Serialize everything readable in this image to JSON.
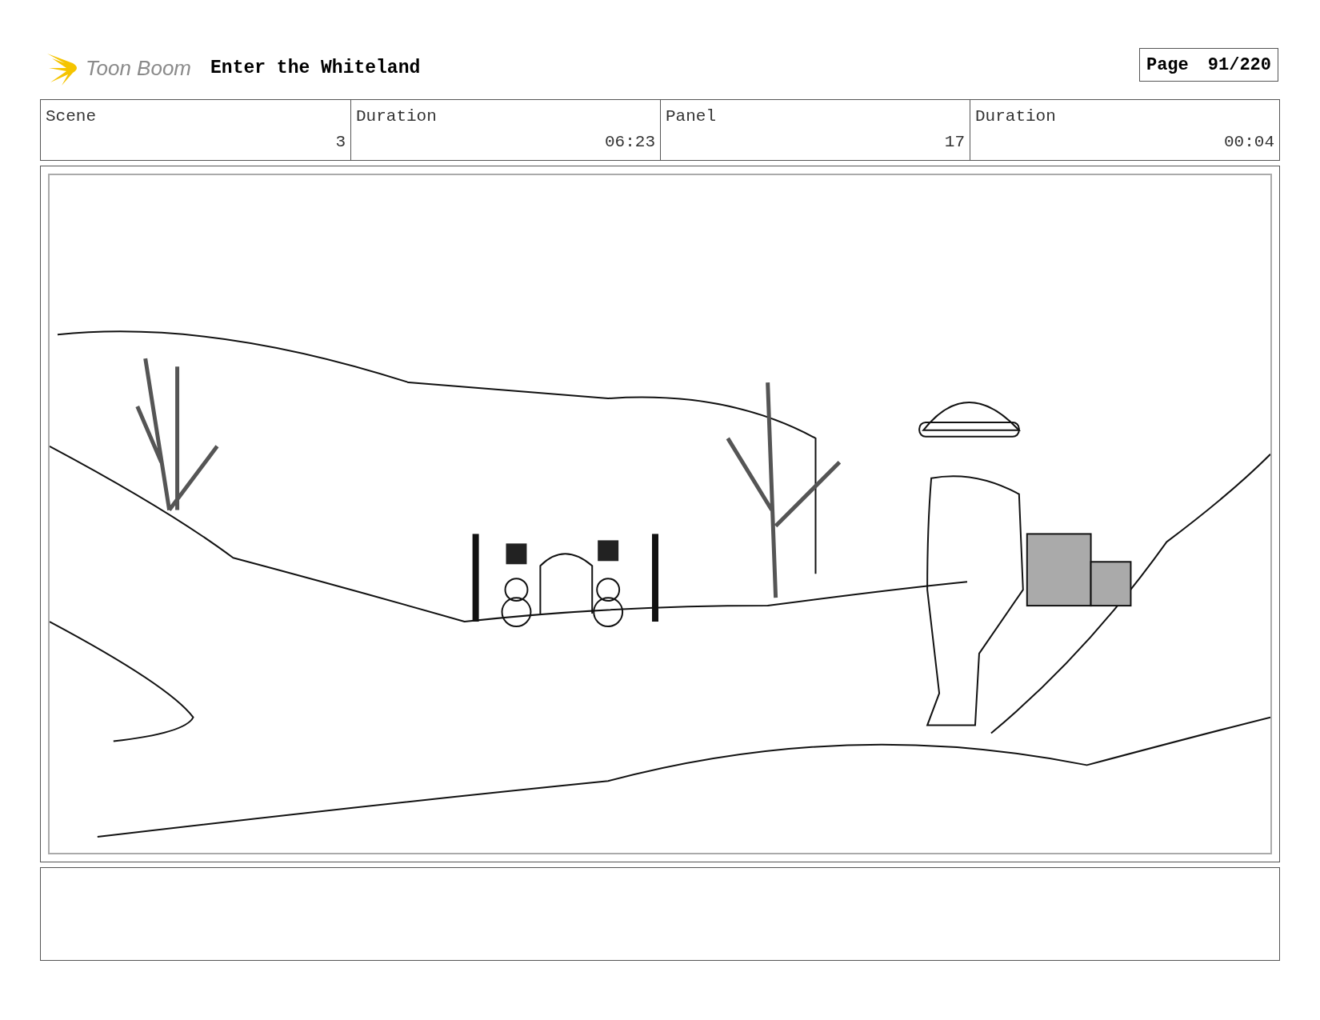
{
  "header": {
    "logo_text": "Toon Boom",
    "title": "Enter the Whiteland",
    "page_label": "Page",
    "page_number": "91/220"
  },
  "info_table": {
    "columns": [
      "Scene",
      "Duration",
      "Panel",
      "Duration"
    ],
    "values": [
      "3",
      "06:23",
      "17",
      "00:04"
    ]
  }
}
